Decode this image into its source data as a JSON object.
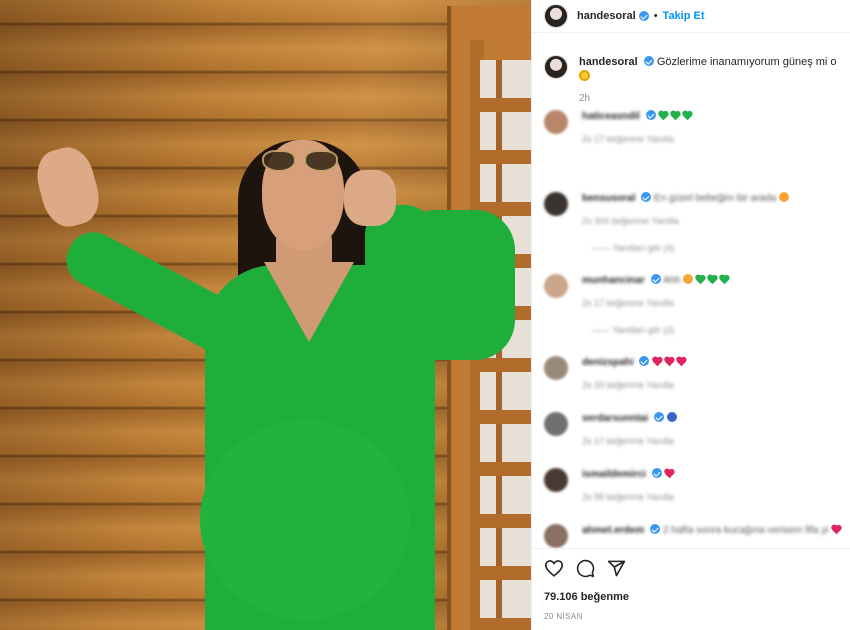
{
  "header": {
    "username": "handesoral",
    "follow_label": "Takip Et",
    "separator": "•"
  },
  "caption": {
    "username": "handesoral",
    "text": "Gözlerime inanamıyorum güneş mi o",
    "time": "2h"
  },
  "comments": [
    {
      "username": "haticeasndil",
      "text": "",
      "hearts": [
        "green",
        "green",
        "green"
      ],
      "meta": "2s   17 beğenme   Yanıtla",
      "replies": ""
    },
    {
      "username": "bensusoral",
      "text": "En güzel bebeğim bir arada",
      "hearts": [],
      "emoji": "face",
      "meta": "2s   304 beğenme   Yanıtla",
      "replies": "——  Yanıtları gör (4)"
    },
    {
      "username": "munhancinar",
      "text": "Ahh",
      "hearts": [
        "green",
        "green",
        "green"
      ],
      "emoji": "face",
      "meta": "2s   17 beğenme   Yanıtla",
      "replies": "——  Yanıtları gör (2)"
    },
    {
      "username": "denizspahi",
      "text": "",
      "hearts": [
        "red",
        "red",
        "red"
      ],
      "meta": "2s   33 beğenme   Yanıtla",
      "replies": ""
    },
    {
      "username": "serdarsunntai",
      "text": "",
      "hearts": [],
      "emoji": "blue",
      "meta": "2s   17 beğenme   Yanıtla",
      "replies": ""
    },
    {
      "username": "ismaildemirci",
      "text": "",
      "hearts": [
        "red"
      ],
      "meta": "2s   98 beğenme   Yanıtla",
      "replies": ""
    },
    {
      "username": "ahmet.erdem",
      "text": "2 hafta sonra kucağına verisem fifa yi",
      "hearts": [
        "red"
      ],
      "meta": "",
      "replies": ""
    }
  ],
  "actions": {
    "likes": "79.106 beğenme",
    "date": "20 NİSAN"
  },
  "colors": {
    "accent": "#0095f6",
    "verified": "#3897f0",
    "dress": "#1fae3a",
    "wood": "#c98a3e"
  },
  "icons": [
    "verified-badge-icon",
    "heart-icon",
    "comment-icon",
    "share-icon",
    "sun-emoji-icon"
  ]
}
